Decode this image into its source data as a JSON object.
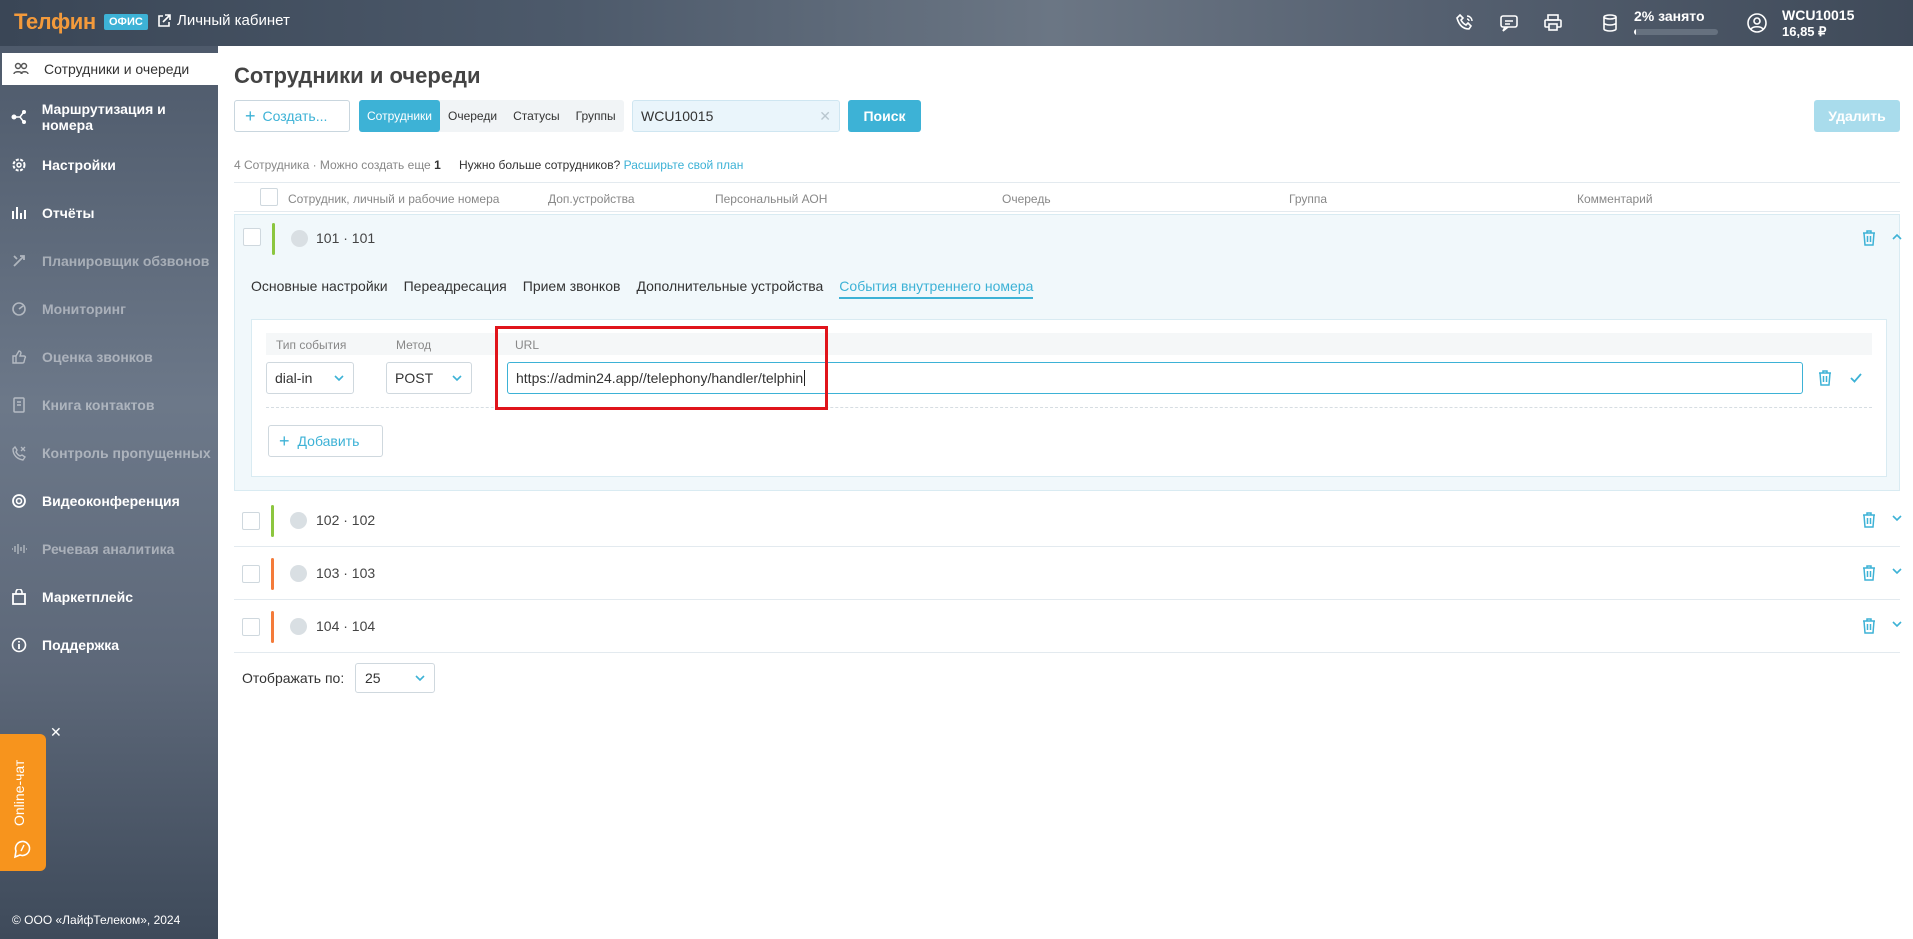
{
  "header": {
    "logo": "Телфин",
    "logo_badge": "ОФИС",
    "cabinet_link": "Личный кабинет",
    "storage_text": "2% занято",
    "storage_percent": 2,
    "account_id": "WCU10015",
    "balance": "16,85 ₽"
  },
  "sidebar": {
    "items": [
      {
        "label": "Сотрудники и очереди",
        "icon": "users-icon",
        "state": "active"
      },
      {
        "label": "Маршрутизация и номера",
        "icon": "routing-icon",
        "state": "normal"
      },
      {
        "label": "Настройки",
        "icon": "gear-icon",
        "state": "normal"
      },
      {
        "label": "Отчёты",
        "icon": "bar-chart-icon",
        "state": "normal"
      },
      {
        "label": "Планировщик обзвонов",
        "icon": "scheduler-icon",
        "state": "disabled"
      },
      {
        "label": "Мониторинг",
        "icon": "monitor-icon",
        "state": "disabled"
      },
      {
        "label": "Оценка звонков",
        "icon": "thumbs-up-icon",
        "state": "disabled"
      },
      {
        "label": "Книга контактов",
        "icon": "contact-book-icon",
        "state": "disabled"
      },
      {
        "label": "Контроль пропущенных",
        "icon": "missed-call-icon",
        "state": "disabled"
      },
      {
        "label": "Видеоконференция",
        "icon": "video-conference-icon",
        "state": "normal"
      },
      {
        "label": "Речевая аналитика",
        "icon": "waveform-icon",
        "state": "disabled"
      },
      {
        "label": "Маркетплейс",
        "icon": "shopping-bag-icon",
        "state": "normal"
      },
      {
        "label": "Поддержка",
        "icon": "info-icon",
        "state": "normal"
      }
    ],
    "chat_label": "Online-чат",
    "copyright": "© ООО «ЛайфТелеком», 2024"
  },
  "page": {
    "title": "Сотрудники и очереди",
    "create_label": "Создать...",
    "tabs": [
      "Сотрудники",
      "Очереди",
      "Статусы",
      "Группы"
    ],
    "search_value": "WCU10015",
    "search_button": "Поиск",
    "delete_button": "Удалить",
    "count_text": "4 Сотрудника · Можно создать еще",
    "count_remaining": "1",
    "need_more": "Нужно больше сотрудников?",
    "upgrade_link": "Расширьте свой план",
    "columns": [
      "Сотрудник, личный и рабочие номера",
      "Доп.устройства",
      "Персональный АОН",
      "Очередь",
      "Группа",
      "Комментарий"
    ],
    "rows": [
      {
        "number": "101 · 101",
        "status_color": "#8cc63f",
        "expanded": true
      },
      {
        "number": "102 · 102",
        "status_color": "#8cc63f",
        "expanded": false
      },
      {
        "number": "103 · 103",
        "status_color": "#f47b3a",
        "expanded": false
      },
      {
        "number": "104 · 104",
        "status_color": "#f47b3a",
        "expanded": false
      }
    ],
    "subtabs": [
      "Основные настройки",
      "Переадресация",
      "Прием звонков",
      "Дополнительные устройства",
      "События внутреннего номера"
    ],
    "active_subtab": "События внутреннего номера",
    "event": {
      "type_label": "Тип события",
      "method_label": "Метод",
      "url_label": "URL",
      "type_value": "dial-in",
      "method_value": "POST",
      "url_value": "https://admin24.app//telephony/handler/telphin"
    },
    "add_label": "Добавить",
    "per_page_label": "Отображать по:",
    "per_page_value": "25"
  },
  "colors": {
    "accent": "#3db2d6",
    "highlight": "#e0141b",
    "chat": "#f7941d"
  }
}
